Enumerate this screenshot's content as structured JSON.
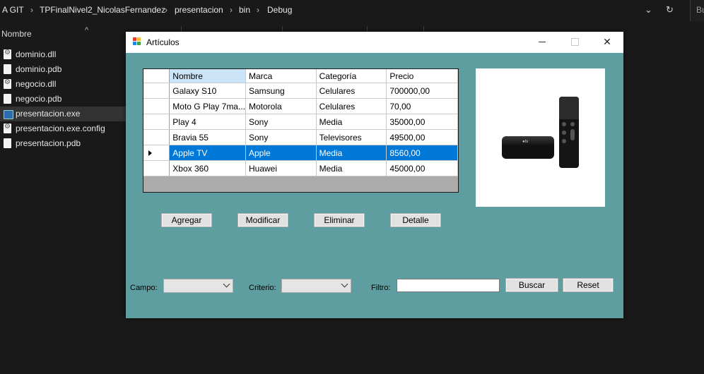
{
  "explorer": {
    "breadcrumbs": [
      "A GIT",
      "TPFinalNivel2_NicolasFernandez",
      "presentacion",
      "bin",
      "Debug"
    ],
    "search_placeholder": "Bu",
    "column_header": "Nombre",
    "files": [
      {
        "name": "dominio.dll",
        "icon": "dll-file-icon"
      },
      {
        "name": "dominio.pdb",
        "icon": "file-icon"
      },
      {
        "name": "negocio.dll",
        "icon": "dll-file-icon"
      },
      {
        "name": "negocio.pdb",
        "icon": "file-icon"
      },
      {
        "name": "presentacion.exe",
        "icon": "exe-icon",
        "selected": true
      },
      {
        "name": "presentacion.exe.config",
        "icon": "config-file-icon"
      },
      {
        "name": "presentacion.pdb",
        "icon": "file-icon"
      }
    ]
  },
  "form": {
    "title": "Artículos",
    "grid": {
      "columns": [
        "Nombre",
        "Marca",
        "Categoría",
        "Precio"
      ],
      "rows": [
        [
          "Galaxy S10",
          "Samsung",
          "Celulares",
          "700000,00"
        ],
        [
          "Moto G Play 7ma...",
          "Motorola",
          "Celulares",
          "70,00"
        ],
        [
          "Play 4",
          "Sony",
          "Media",
          "35000,00"
        ],
        [
          "Bravia 55",
          "Sony",
          "Televisores",
          "49500,00"
        ],
        [
          "Apple TV",
          "Apple",
          "Media",
          "8560,00"
        ],
        [
          "Xbox 360",
          "Huawei",
          "Media",
          "45000,00"
        ]
      ],
      "selected_row": 4,
      "selection_color": "#0078d7"
    },
    "buttons": {
      "agregar": "Agregar",
      "modificar": "Modificar",
      "eliminar": "Eliminar",
      "detalle": "Detalle",
      "buscar": "Buscar",
      "reset": "Reset"
    },
    "filters": {
      "campo_label": "Campo:",
      "criterio_label": "Criterio:",
      "filtro_label": "Filtro:",
      "campo_value": "",
      "criterio_value": "",
      "filtro_value": ""
    },
    "background_color": "#5f9ea0"
  }
}
